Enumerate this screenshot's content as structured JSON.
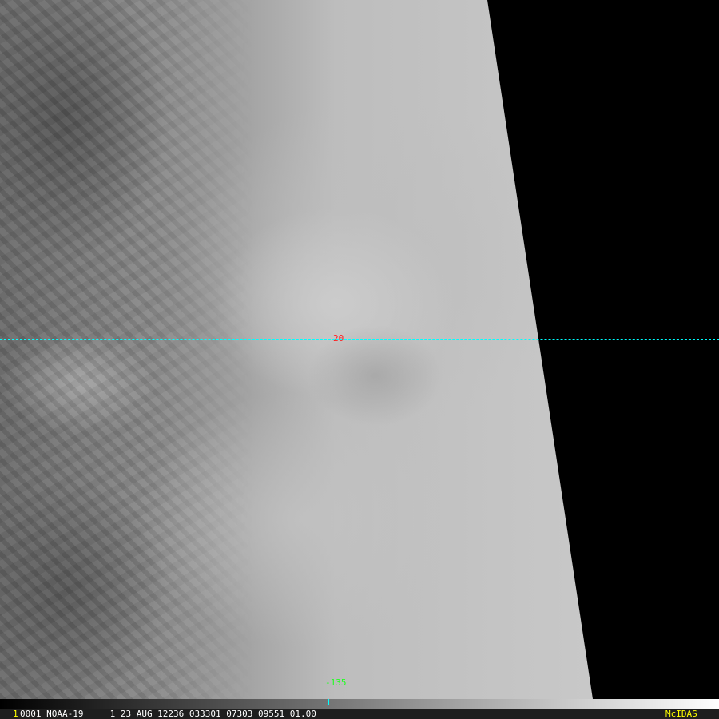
{
  "image": {
    "type": "satellite-infrared",
    "gridlines": {
      "latitude_label": "20",
      "longitude_label": "-135"
    },
    "colors": {
      "latitude_line": "#00ffff",
      "latitude_label": "#ff2020",
      "longitude_label": "#20ff20",
      "brand": "#ffff00"
    }
  },
  "info_bar": {
    "frame_number": "1",
    "text": "0001 NOAA-19     1 23 AUG 12236 033301 07303 09551 01.00",
    "brand": "McIDAS"
  }
}
